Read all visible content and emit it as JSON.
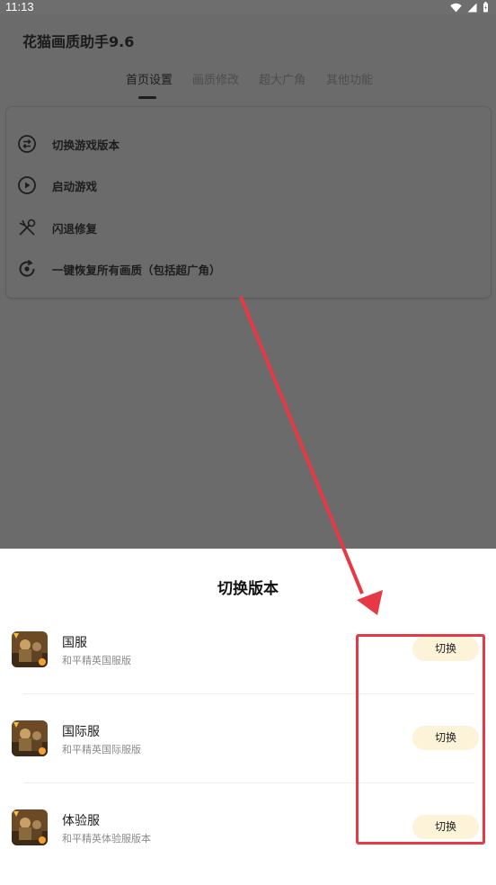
{
  "status_bar": {
    "time": "11:13"
  },
  "app": {
    "title": "花猫画质助手9.6",
    "tabs": [
      {
        "label": "首页设置",
        "active": true
      },
      {
        "label": "画质修改",
        "active": false
      },
      {
        "label": "超大广角",
        "active": false
      },
      {
        "label": "其他功能",
        "active": false
      }
    ],
    "menu": [
      {
        "label": "切换游戏版本",
        "icon": "swap-circle-icon"
      },
      {
        "label": "启动游戏",
        "icon": "play-circle-icon"
      },
      {
        "label": "闪退修复",
        "icon": "wrench-screwdriver-icon"
      },
      {
        "label": "一键恢复所有画质（包括超广角）",
        "icon": "restore-icon"
      }
    ]
  },
  "sheet": {
    "title": "切换版本",
    "options": [
      {
        "name": "国服",
        "subtitle": "和平精英国服版",
        "button": "切换"
      },
      {
        "name": "国际服",
        "subtitle": "和平精英国际服版",
        "button": "切换"
      },
      {
        "name": "体验服",
        "subtitle": "和平精英体验服版本",
        "button": "切换"
      }
    ]
  },
  "colors": {
    "scrim": "#6b6b6b",
    "button_bg": "#fdf3d9",
    "annotation": "#e53a45"
  }
}
